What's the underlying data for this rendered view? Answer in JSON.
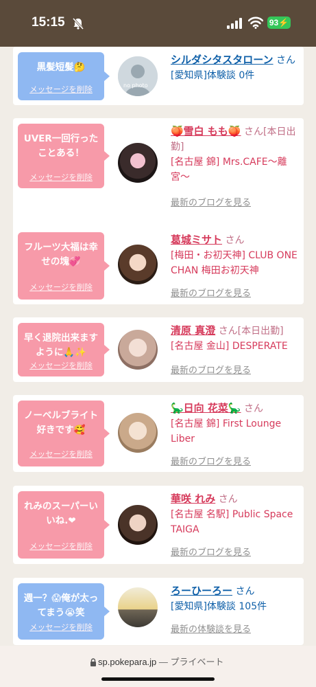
{
  "status": {
    "time": "15:15",
    "battery": "93"
  },
  "cards": [
    {
      "bubble_color": "blue",
      "message": "黒髪短髪🤔",
      "delete_label": "メッセージを削除",
      "avatar": "no-photo",
      "avatar_text": "no photo",
      "name": "シルダシタスタローン",
      "name_color": "blue",
      "suffix": "さん",
      "shop": "[愛知県]体験談 0件",
      "shop_color": "blue",
      "link": ""
    },
    {
      "bubble_color": "pink",
      "message": "UVER一回行ったことある！",
      "delete_label": "メッセージを削除",
      "avatar": "photo",
      "name": "🍑雪白 もも🍑",
      "name_color": "pink",
      "suffix": "さん[本日出勤]",
      "shop": "[名古屋 錦] Mrs.CAFE〜離宮〜",
      "shop_color": "pink",
      "link": "最新のブログを見る"
    },
    {
      "bubble_color": "pink",
      "message": "フルーツ大福は幸せの塊💞",
      "delete_label": "メッセージを削除",
      "avatar": "photo",
      "name": "葛城ミサト",
      "name_color": "pink",
      "suffix": "さん",
      "shop": "[梅田・お初天神] CLUB ONE CHAN 梅田お初天神",
      "shop_color": "pink",
      "link": "最新のブログを見る"
    },
    {
      "bubble_color": "pink",
      "message": "早く退院出来ますように🙏✨",
      "delete_label": "メッセージを削除",
      "avatar": "photo",
      "name": "清原 真澄",
      "name_color": "pink",
      "suffix": "さん[本日出勤]",
      "shop": "[名古屋 金山] DESPERATE",
      "shop_color": "pink",
      "link": "最新のブログを見る"
    },
    {
      "bubble_color": "pink",
      "message": "ノーベルブライト好きです🥰",
      "delete_label": "メッセージを削除",
      "avatar": "photo",
      "name": "🦕日向 花菜🦕",
      "name_color": "pink",
      "suffix": "さん",
      "shop": "[名古屋 錦] First Lounge Liber",
      "shop_color": "pink",
      "link": "最新のブログを見る"
    },
    {
      "bubble_color": "pink",
      "message": "れみのスーパーいいね.❤︎",
      "delete_label": "メッセージを削除",
      "avatar": "photo",
      "name": "華咲 れみ",
      "name_color": "pink",
      "suffix": "さん",
      "shop": "[名古屋 名駅] Public Space TAIGA",
      "shop_color": "pink",
      "link": "最新のブログを見る"
    },
    {
      "bubble_color": "blue",
      "message": "週一？😱俺が太ってまう😭笑",
      "delete_label": "メッセージを削除",
      "avatar": "photo",
      "name": "ろーひーろー",
      "name_color": "blue",
      "suffix": "さん",
      "shop": "[愛知県]体験談 105件",
      "shop_color": "blue",
      "link": "最新の体験談を見る"
    }
  ],
  "url_bar": {
    "domain": "sp.pokepara.jp",
    "mode": "— プライベート"
  }
}
